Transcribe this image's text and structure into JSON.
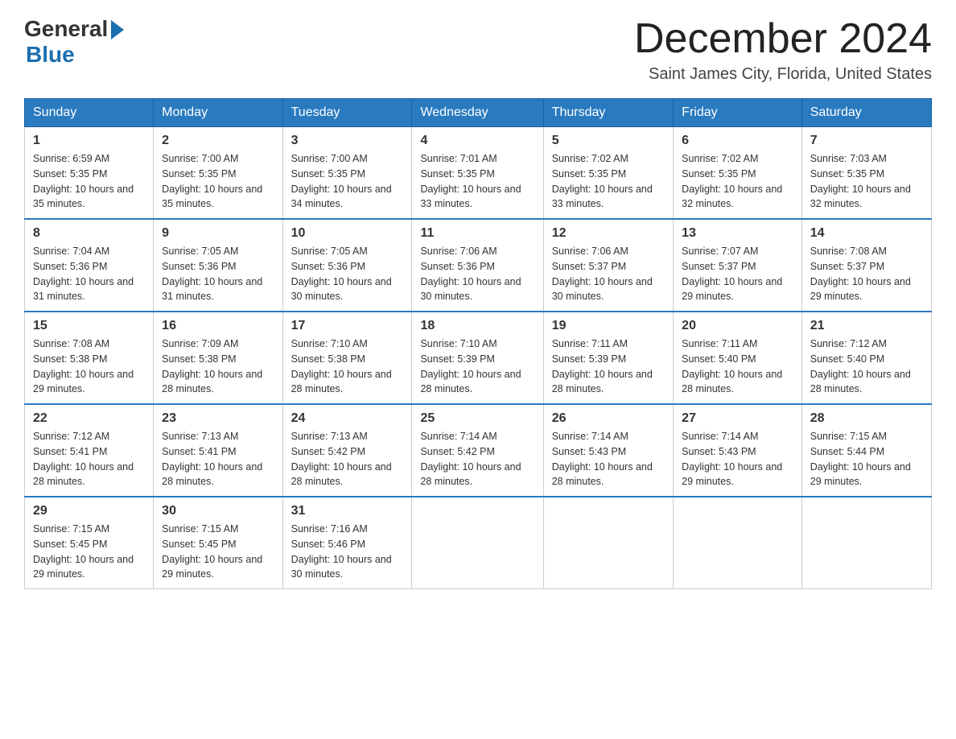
{
  "logo": {
    "general": "General",
    "blue": "Blue"
  },
  "header": {
    "month": "December 2024",
    "location": "Saint James City, Florida, United States"
  },
  "days_of_week": [
    "Sunday",
    "Monday",
    "Tuesday",
    "Wednesday",
    "Thursday",
    "Friday",
    "Saturday"
  ],
  "weeks": [
    [
      {
        "day": "1",
        "sunrise": "6:59 AM",
        "sunset": "5:35 PM",
        "daylight": "10 hours and 35 minutes."
      },
      {
        "day": "2",
        "sunrise": "7:00 AM",
        "sunset": "5:35 PM",
        "daylight": "10 hours and 35 minutes."
      },
      {
        "day": "3",
        "sunrise": "7:00 AM",
        "sunset": "5:35 PM",
        "daylight": "10 hours and 34 minutes."
      },
      {
        "day": "4",
        "sunrise": "7:01 AM",
        "sunset": "5:35 PM",
        "daylight": "10 hours and 33 minutes."
      },
      {
        "day": "5",
        "sunrise": "7:02 AM",
        "sunset": "5:35 PM",
        "daylight": "10 hours and 33 minutes."
      },
      {
        "day": "6",
        "sunrise": "7:02 AM",
        "sunset": "5:35 PM",
        "daylight": "10 hours and 32 minutes."
      },
      {
        "day": "7",
        "sunrise": "7:03 AM",
        "sunset": "5:35 PM",
        "daylight": "10 hours and 32 minutes."
      }
    ],
    [
      {
        "day": "8",
        "sunrise": "7:04 AM",
        "sunset": "5:36 PM",
        "daylight": "10 hours and 31 minutes."
      },
      {
        "day": "9",
        "sunrise": "7:05 AM",
        "sunset": "5:36 PM",
        "daylight": "10 hours and 31 minutes."
      },
      {
        "day": "10",
        "sunrise": "7:05 AM",
        "sunset": "5:36 PM",
        "daylight": "10 hours and 30 minutes."
      },
      {
        "day": "11",
        "sunrise": "7:06 AM",
        "sunset": "5:36 PM",
        "daylight": "10 hours and 30 minutes."
      },
      {
        "day": "12",
        "sunrise": "7:06 AM",
        "sunset": "5:37 PM",
        "daylight": "10 hours and 30 minutes."
      },
      {
        "day": "13",
        "sunrise": "7:07 AM",
        "sunset": "5:37 PM",
        "daylight": "10 hours and 29 minutes."
      },
      {
        "day": "14",
        "sunrise": "7:08 AM",
        "sunset": "5:37 PM",
        "daylight": "10 hours and 29 minutes."
      }
    ],
    [
      {
        "day": "15",
        "sunrise": "7:08 AM",
        "sunset": "5:38 PM",
        "daylight": "10 hours and 29 minutes."
      },
      {
        "day": "16",
        "sunrise": "7:09 AM",
        "sunset": "5:38 PM",
        "daylight": "10 hours and 28 minutes."
      },
      {
        "day": "17",
        "sunrise": "7:10 AM",
        "sunset": "5:38 PM",
        "daylight": "10 hours and 28 minutes."
      },
      {
        "day": "18",
        "sunrise": "7:10 AM",
        "sunset": "5:39 PM",
        "daylight": "10 hours and 28 minutes."
      },
      {
        "day": "19",
        "sunrise": "7:11 AM",
        "sunset": "5:39 PM",
        "daylight": "10 hours and 28 minutes."
      },
      {
        "day": "20",
        "sunrise": "7:11 AM",
        "sunset": "5:40 PM",
        "daylight": "10 hours and 28 minutes."
      },
      {
        "day": "21",
        "sunrise": "7:12 AM",
        "sunset": "5:40 PM",
        "daylight": "10 hours and 28 minutes."
      }
    ],
    [
      {
        "day": "22",
        "sunrise": "7:12 AM",
        "sunset": "5:41 PM",
        "daylight": "10 hours and 28 minutes."
      },
      {
        "day": "23",
        "sunrise": "7:13 AM",
        "sunset": "5:41 PM",
        "daylight": "10 hours and 28 minutes."
      },
      {
        "day": "24",
        "sunrise": "7:13 AM",
        "sunset": "5:42 PM",
        "daylight": "10 hours and 28 minutes."
      },
      {
        "day": "25",
        "sunrise": "7:14 AM",
        "sunset": "5:42 PM",
        "daylight": "10 hours and 28 minutes."
      },
      {
        "day": "26",
        "sunrise": "7:14 AM",
        "sunset": "5:43 PM",
        "daylight": "10 hours and 28 minutes."
      },
      {
        "day": "27",
        "sunrise": "7:14 AM",
        "sunset": "5:43 PM",
        "daylight": "10 hours and 29 minutes."
      },
      {
        "day": "28",
        "sunrise": "7:15 AM",
        "sunset": "5:44 PM",
        "daylight": "10 hours and 29 minutes."
      }
    ],
    [
      {
        "day": "29",
        "sunrise": "7:15 AM",
        "sunset": "5:45 PM",
        "daylight": "10 hours and 29 minutes."
      },
      {
        "day": "30",
        "sunrise": "7:15 AM",
        "sunset": "5:45 PM",
        "daylight": "10 hours and 29 minutes."
      },
      {
        "day": "31",
        "sunrise": "7:16 AM",
        "sunset": "5:46 PM",
        "daylight": "10 hours and 30 minutes."
      },
      null,
      null,
      null,
      null
    ]
  ]
}
